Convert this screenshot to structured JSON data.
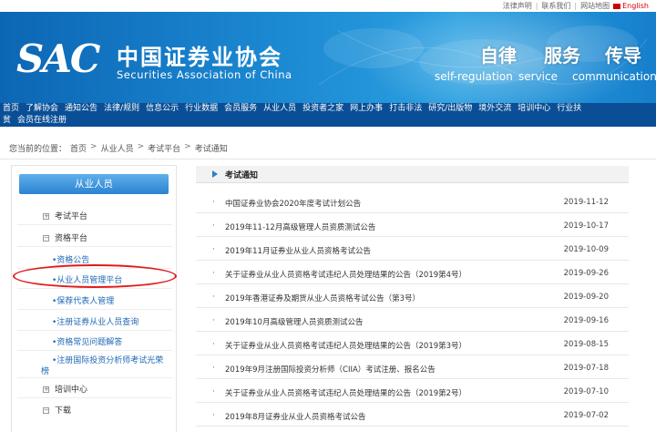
{
  "util": {
    "links": [
      "法律声明",
      "联系我们",
      "网站地图"
    ],
    "english": "English"
  },
  "header": {
    "logo_text": "SAC",
    "name_cn": "中国证券业协会",
    "name_en": "Securities Association of China",
    "slogans": [
      {
        "cn": "自律",
        "en": "self-regulation"
      },
      {
        "cn": "服务",
        "en": "service"
      },
      {
        "cn": "传导",
        "en": "communication"
      }
    ]
  },
  "nav": {
    "row1": [
      "首页",
      "了解协会",
      "通知公告",
      "法律/规则",
      "信息公示",
      "行业数据",
      "会员服务",
      "从业人员",
      "投资者之家",
      "网上办事",
      "打击非法",
      "研究/出版物",
      "境外交流",
      "培训中心",
      "行业扶"
    ],
    "row2": [
      "贫",
      "会员在线注册"
    ]
  },
  "breadcrumb": {
    "prefix": "您当前的位置：",
    "items": [
      "首页",
      "从业人员",
      "考试平台",
      "考试通知"
    ]
  },
  "sidebar": {
    "title": "从业人员",
    "items": [
      {
        "label": "考试平台",
        "toggle": "+"
      },
      {
        "label": "资格平台",
        "toggle": "−"
      },
      {
        "label": "•资格公告"
      },
      {
        "label": "•从业人员管理平台"
      },
      {
        "label": "•保荐代表人管理"
      },
      {
        "label": "•注册证券从业人员查询"
      },
      {
        "label": "•资格常见问题解答"
      },
      {
        "label": "•注册国际投资分析师考试光荣"
      },
      {
        "label": "榜"
      },
      {
        "label": "培训中心",
        "toggle": "+"
      },
      {
        "label": "下载",
        "toggle": "−"
      }
    ]
  },
  "main": {
    "section_title": "考试通知",
    "news": [
      {
        "title": "中国证券业协会2020年度考试计划公告",
        "date": "2019-11-12"
      },
      {
        "title": "2019年11-12月高级管理人员资质测试公告",
        "date": "2019-10-17"
      },
      {
        "title": "2019年11月证券业从业人员资格考试公告",
        "date": "2019-10-09"
      },
      {
        "title": "关于证券业从业人员资格考试违纪人员处理结果的公告（2019第4号）",
        "date": "2019-09-26"
      },
      {
        "title": "2019年香港证券及期货从业人员资格考试公告（第3号）",
        "date": "2019-09-20"
      },
      {
        "title": "2019年10月高级管理人员资质测试公告",
        "date": "2019-09-16"
      },
      {
        "title": "关于证券业从业人员资格考试违纪人员处理结果的公告（2019第3号）",
        "date": "2019-08-15"
      },
      {
        "title": "2019年9月注册国际投资分析师（CIIA）考试注册、报名公告",
        "date": "2019-07-18"
      },
      {
        "title": "关于证券业从业人员资格考试违纪人员处理结果的公告（2019第2号）",
        "date": "2019-07-10"
      },
      {
        "title": "2019年8月证券业从业人员资格考试公告",
        "date": "2019-07-02"
      }
    ]
  },
  "colors": {
    "nav_bg": "#0a4f96",
    "header_blue": "#1d8bd4",
    "highlight_oval": "#e01b1b",
    "link_blue": "#2069b5"
  }
}
